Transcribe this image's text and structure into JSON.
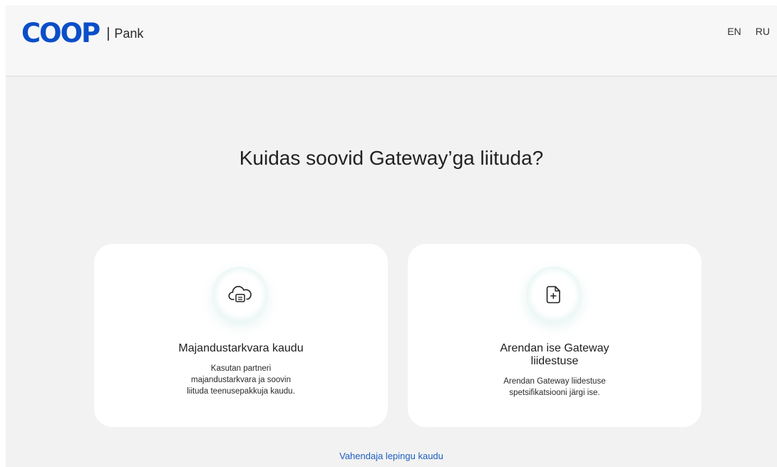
{
  "header": {
    "logo": {
      "brand": "COOP",
      "separator": "|",
      "sub": "Pank"
    },
    "languages": [
      "EN",
      "RU"
    ]
  },
  "main": {
    "title": "Kuidas soovid Gateway’ga liituda?",
    "options": [
      {
        "icon": "cloud-document-icon",
        "title": "Majandustarkvara kaudu",
        "description_lines": [
          "Kasutan partneri",
          "majandustarkvara ja soovin",
          "liituda teenusepakkuja kaudu."
        ]
      },
      {
        "icon": "document-plus-icon",
        "title_lines": [
          "Arendan ise Gateway",
          "liidestuse"
        ],
        "description_lines": [
          "Arendan Gateway liidestuse",
          "spetsifikatsiooni järgi ise."
        ]
      }
    ],
    "link": "Vahendaja lepingu kaudu"
  },
  "colors": {
    "brand": "#0b4ec8",
    "link": "#1f5fbf",
    "background": "#f2f2f2"
  }
}
